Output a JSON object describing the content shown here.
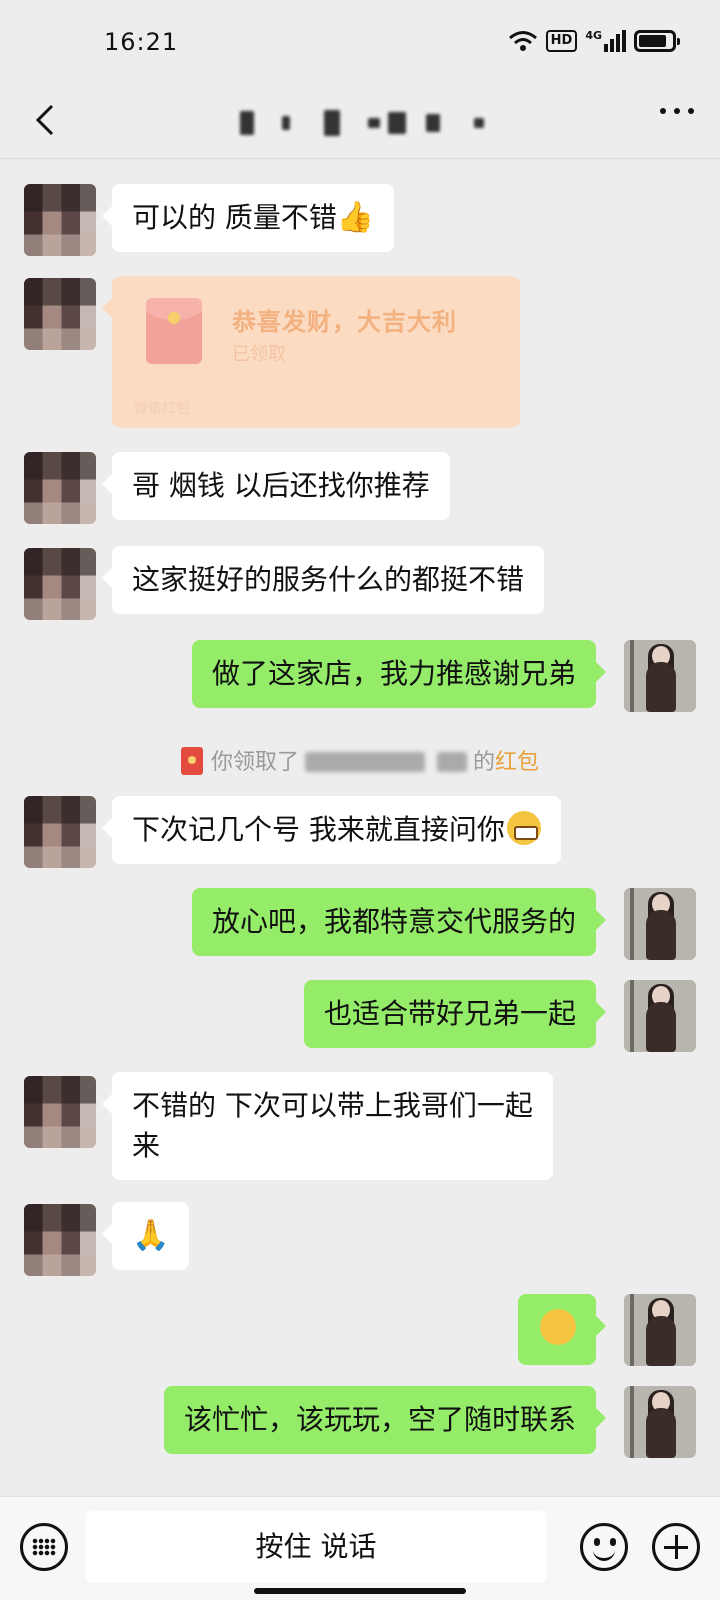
{
  "status_bar": {
    "time": "16:21",
    "hd_label": "HD",
    "network_label": "4G",
    "battery_level": 0.85
  },
  "title_bar": {
    "back_icon": "chevron-left-icon",
    "more_icon": "more-horizontal-icon"
  },
  "messages": [
    {
      "side": "them",
      "text": "可以的 质量不错",
      "emoji": "thumbs-up"
    },
    {
      "side": "them",
      "type": "red_packet",
      "title": "恭喜发财，大吉大利",
      "status": "已领取",
      "footer": "微信红包"
    },
    {
      "side": "them",
      "text": "哥 烟钱 以后还找你推荐"
    },
    {
      "side": "them",
      "text": "这家挺好的服务什么的都挺不错"
    },
    {
      "side": "me",
      "text": "做了这家店，我力推感谢兄弟"
    },
    {
      "type": "system",
      "prefix": "你领取了",
      "suffix": "的",
      "link": "红包"
    },
    {
      "side": "them",
      "text": "下次记几个号 我来就直接问你",
      "emoji": "grin"
    },
    {
      "side": "me",
      "text": "放心吧，我都特意交代服务的"
    },
    {
      "side": "me",
      "text": "也适合带好兄弟一起"
    },
    {
      "side": "them",
      "text_line1": "不错的 下次可以带上我哥们一起",
      "text_line2": "来"
    },
    {
      "side": "them",
      "emoji": "pray"
    },
    {
      "side": "me",
      "emoji": "thinking"
    },
    {
      "side": "me",
      "text": "该忙忙，该玩玩，空了随时联系"
    }
  ],
  "input_bar": {
    "hold_to_talk": "按住 说话",
    "keyboard_icon": "keyboard-icon",
    "emoji_icon": "emoji-icon",
    "plus_icon": "plus-icon"
  },
  "colors": {
    "background": "#ededed",
    "outgoing_bubble": "#95ec69",
    "incoming_bubble": "#ffffff",
    "red_packet_bg": "#fbdcc2",
    "link_orange": "#e9a23b"
  }
}
